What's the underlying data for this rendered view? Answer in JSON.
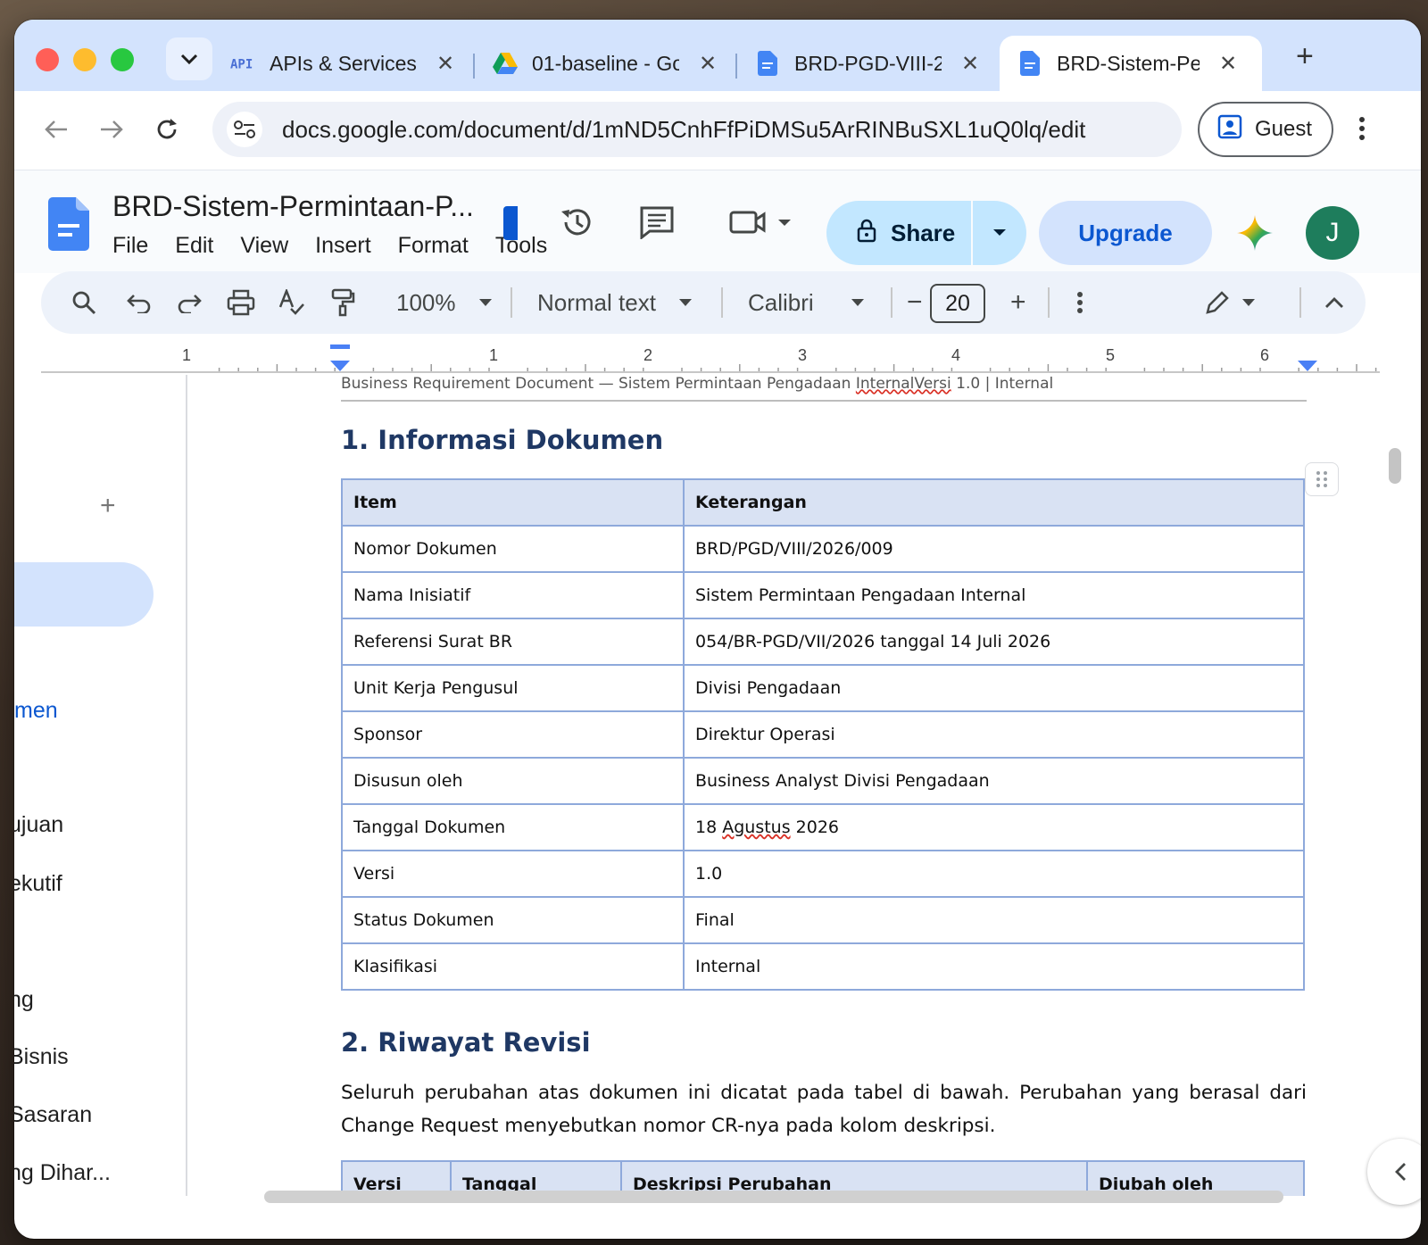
{
  "browser": {
    "tabs": [
      {
        "icon": "api-icon",
        "label": "APIs & Services",
        "active": false
      },
      {
        "icon": "google-drive-icon",
        "label": "01-baseline - Go",
        "active": false
      },
      {
        "icon": "google-docs-icon",
        "label": "BRD-PGD-VIII-2",
        "active": false
      },
      {
        "icon": "google-docs-icon",
        "label": "BRD-Sistem-Per",
        "active": true
      }
    ],
    "url": "docs.google.com/document/d/1mND5CnhFfPiDMSu5ArRINBuSXL1uQ0lq/edit",
    "profile_label": "Guest"
  },
  "docs": {
    "title": "BRD-Sistem-Permintaan-P...",
    "menu": [
      "File",
      "Edit",
      "View",
      "Insert",
      "Format",
      "Tools"
    ],
    "share_label": "Share",
    "upgrade_label": "Upgrade",
    "avatar_initial": "J",
    "colors": {
      "share_bg": "#c2e7ff",
      "upgrade_bg": "#d3e3fd",
      "avatar_bg": "#1e7d5c",
      "heading": "#1f3864",
      "table_header_bg": "#d9e2f3",
      "table_border": "#8ea9db"
    }
  },
  "toolbar": {
    "zoom": "100%",
    "style": "Normal text",
    "font": "Calibri",
    "font_size": "20"
  },
  "ruler": {
    "labels": [
      "1",
      "1",
      "2",
      "3",
      "4",
      "5",
      "6"
    ]
  },
  "outline": {
    "items": [
      "men",
      "ujuan",
      "ekutif",
      "ng",
      "Bisnis",
      "Sasaran",
      "ng Dihar..."
    ]
  },
  "document": {
    "page_header_prefix": "Business Requirement Document — Sistem Permintaan Pengadaan ",
    "page_header_squiggle": "InternalVersi",
    "page_header_suffix": " 1.0 | Internal",
    "section1_title": "1. Informasi Dokumen",
    "info_table": {
      "headers": [
        "Item",
        "Keterangan"
      ],
      "rows": [
        [
          "Nomor Dokumen",
          "BRD/PGD/VIII/2026/009"
        ],
        [
          "Nama Inisiatif",
          "Sistem Permintaan Pengadaan Internal"
        ],
        [
          "Referensi Surat BR",
          "054/BR-PGD/VII/2026 tanggal 14 Juli 2026"
        ],
        [
          "Unit Kerja Pengusul",
          "Divisi Pengadaan"
        ],
        [
          "Sponsor",
          "Direktur Operasi"
        ],
        [
          "Disusun oleh",
          "Business Analyst Divisi Pengadaan"
        ],
        [
          "Tanggal Dokumen",
          "18 Agustus 2026"
        ],
        [
          "Versi",
          "1.0"
        ],
        [
          "Status Dokumen",
          "Final"
        ],
        [
          "Klasifikasi",
          "Internal"
        ]
      ]
    },
    "section2_title": "2. Riwayat Revisi",
    "section2_paragraph": "Seluruh perubahan atas dokumen ini dicatat pada tabel di bawah. Perubahan yang berasal dari Change Request menyebutkan nomor CR-nya pada kolom deskripsi.",
    "revision_table_headers": [
      "Versi",
      "Tanggal",
      "Deskripsi Perubahan",
      "Diubah oleh"
    ]
  }
}
